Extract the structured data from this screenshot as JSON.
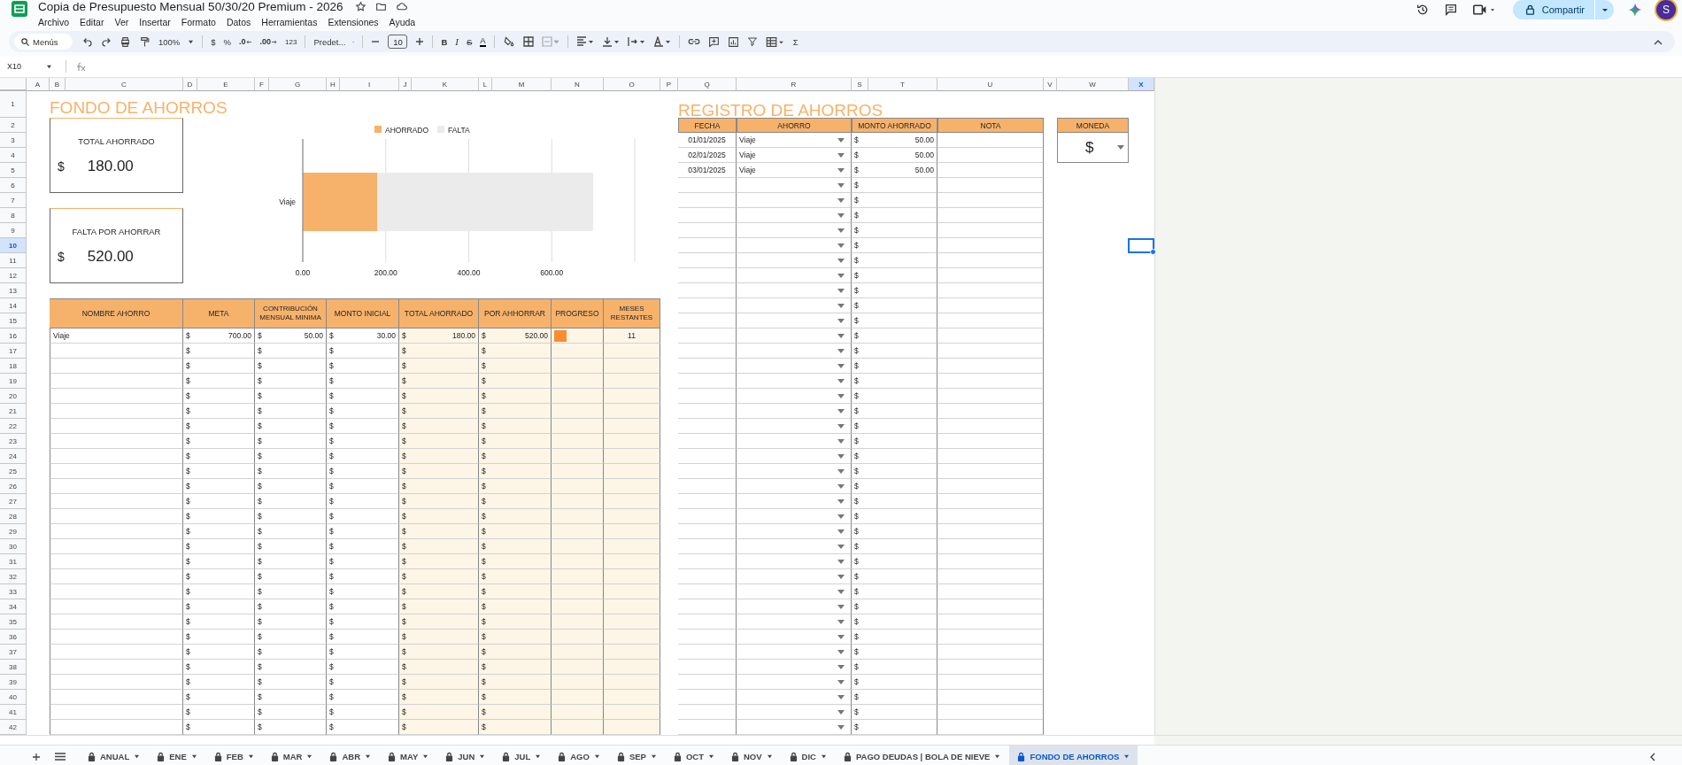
{
  "app": {
    "title": "Copia de Presupuesto Mensual 50/30/20 Premium - 2026",
    "menus": [
      "Archivo",
      "Editar",
      "Ver",
      "Insertar",
      "Formato",
      "Datos",
      "Herramientas",
      "Extensiones",
      "Ayuda"
    ],
    "share_button": "Compartir",
    "avatar": "S"
  },
  "toolbar": {
    "search_placeholder": "Menús",
    "zoom": "100%",
    "currency": "$",
    "percent": "%",
    "decrease_decimals": ".0",
    "increase_decimals": ".00",
    "number_format": "123",
    "font": "Predet...",
    "font_size": "10",
    "bold": "B",
    "italic": "I",
    "strikethrough": "S",
    "text_color": "A",
    "functions": "Σ"
  },
  "formula_bar": {
    "cell_ref": "X10"
  },
  "columns": [
    {
      "label": "A",
      "selected": false
    },
    {
      "label": "B",
      "selected": false
    },
    {
      "label": "C",
      "selected": false
    },
    {
      "label": "D",
      "selected": false
    },
    {
      "label": "E",
      "selected": false
    },
    {
      "label": "F",
      "selected": false
    },
    {
      "label": "G",
      "selected": false
    },
    {
      "label": "H",
      "selected": false
    },
    {
      "label": "I",
      "selected": false
    },
    {
      "label": "J",
      "selected": false
    },
    {
      "label": "K",
      "selected": false
    },
    {
      "label": "L",
      "selected": false
    },
    {
      "label": "M",
      "selected": false
    },
    {
      "label": "N",
      "selected": false
    },
    {
      "label": "O",
      "selected": false
    },
    {
      "label": "P",
      "selected": false
    },
    {
      "label": "Q",
      "selected": false
    },
    {
      "label": "R",
      "selected": false
    },
    {
      "label": "S",
      "selected": false
    },
    {
      "label": "T",
      "selected": false
    },
    {
      "label": "U",
      "selected": false
    },
    {
      "label": "V",
      "selected": false
    },
    {
      "label": "W",
      "selected": false
    },
    {
      "label": "X",
      "selected": true
    }
  ],
  "rows": [
    {
      "label": "1",
      "selected": false
    },
    {
      "label": "2",
      "selected": false
    },
    {
      "label": "3",
      "selected": false
    },
    {
      "label": "4",
      "selected": false
    },
    {
      "label": "5",
      "selected": false
    },
    {
      "label": "6",
      "selected": false
    },
    {
      "label": "7",
      "selected": false
    },
    {
      "label": "8",
      "selected": false
    },
    {
      "label": "9",
      "selected": false
    },
    {
      "label": "10",
      "selected": true
    },
    {
      "label": "11",
      "selected": false
    },
    {
      "label": "12",
      "selected": false
    },
    {
      "label": "13",
      "selected": false
    },
    {
      "label": "14",
      "selected": false
    },
    {
      "label": "15",
      "selected": false
    },
    {
      "label": "16",
      "selected": false
    },
    {
      "label": "17",
      "selected": false
    },
    {
      "label": "18",
      "selected": false
    },
    {
      "label": "19",
      "selected": false
    },
    {
      "label": "20",
      "selected": false
    },
    {
      "label": "21",
      "selected": false
    },
    {
      "label": "22",
      "selected": false
    },
    {
      "label": "23",
      "selected": false
    },
    {
      "label": "24",
      "selected": false
    },
    {
      "label": "25",
      "selected": false
    },
    {
      "label": "26",
      "selected": false
    },
    {
      "label": "27",
      "selected": false
    },
    {
      "label": "28",
      "selected": false
    },
    {
      "label": "29",
      "selected": false
    },
    {
      "label": "30",
      "selected": false
    },
    {
      "label": "31",
      "selected": false
    },
    {
      "label": "32",
      "selected": false
    },
    {
      "label": "33",
      "selected": false
    },
    {
      "label": "34",
      "selected": false
    },
    {
      "label": "35",
      "selected": false
    },
    {
      "label": "36",
      "selected": false
    },
    {
      "label": "37",
      "selected": false
    },
    {
      "label": "38",
      "selected": false
    },
    {
      "label": "39",
      "selected": false
    },
    {
      "label": "40",
      "selected": false
    },
    {
      "label": "41",
      "selected": false
    },
    {
      "label": "42",
      "selected": false
    }
  ],
  "savings_fund": {
    "title": "FONDO DE AHORROS",
    "cards": [
      {
        "label": "TOTAL AHORRADO",
        "currency": "$",
        "value": "180.00"
      },
      {
        "label": "FALTA POR AHORRAR",
        "currency": "$",
        "value": "520.00"
      }
    ],
    "chart_data": {
      "type": "bar",
      "orientation": "horizontal",
      "stacked": true,
      "grid": true,
      "legend": true,
      "categories": [
        "Viaje"
      ],
      "xlim": [
        0,
        800
      ],
      "xticks": [
        {
          "value": 0,
          "label": "0.00"
        },
        {
          "value": 200,
          "label": "200.00"
        },
        {
          "value": 400,
          "label": "400.00"
        },
        {
          "value": 600,
          "label": "600.00"
        }
      ],
      "series": [
        {
          "name": "AHORRADO",
          "color": "#f6b26b",
          "values": [
            180
          ]
        },
        {
          "name": "FALTA",
          "color": "#ebebeb",
          "values": [
            520
          ]
        }
      ]
    },
    "table": {
      "columns": [
        "NOMBRE AHORRO",
        "META",
        "CONTRIBUCIÓN MENSUAL MINIMA",
        "MONTO INICIAL",
        "TOTAL AHORRADO",
        "POR AHHORRAR",
        "PROGRESO",
        "MESES RESTANTES"
      ],
      "rows": [
        {
          "name": "Viaje",
          "money": [
            {
              "currency": "$",
              "amount": "700.00"
            },
            {
              "currency": "$",
              "amount": "50.00"
            },
            {
              "currency": "$",
              "amount": "30.00"
            },
            {
              "currency": "$",
              "amount": "180.00"
            },
            {
              "currency": "$",
              "amount": "520.00"
            }
          ],
          "progress": {
            "level": 0.26
          },
          "months": "11"
        },
        {
          "money": [
            {
              "currency": "$"
            },
            {
              "currency": "$"
            },
            {
              "currency": "$"
            },
            {
              "currency": "$"
            },
            {
              "currency": "$"
            }
          ]
        },
        {
          "money": [
            {
              "currency": "$"
            },
            {
              "currency": "$"
            },
            {
              "currency": "$"
            },
            {
              "currency": "$"
            },
            {
              "currency": "$"
            }
          ]
        },
        {
          "money": [
            {
              "currency": "$"
            },
            {
              "currency": "$"
            },
            {
              "currency": "$"
            },
            {
              "currency": "$"
            },
            {
              "currency": "$"
            }
          ]
        },
        {
          "money": [
            {
              "currency": "$"
            },
            {
              "currency": "$"
            },
            {
              "currency": "$"
            },
            {
              "currency": "$"
            },
            {
              "currency": "$"
            }
          ]
        },
        {
          "money": [
            {
              "currency": "$"
            },
            {
              "currency": "$"
            },
            {
              "currency": "$"
            },
            {
              "currency": "$"
            },
            {
              "currency": "$"
            }
          ]
        },
        {
          "money": [
            {
              "currency": "$"
            },
            {
              "currency": "$"
            },
            {
              "currency": "$"
            },
            {
              "currency": "$"
            },
            {
              "currency": "$"
            }
          ]
        },
        {
          "money": [
            {
              "currency": "$"
            },
            {
              "currency": "$"
            },
            {
              "currency": "$"
            },
            {
              "currency": "$"
            },
            {
              "currency": "$"
            }
          ]
        },
        {
          "money": [
            {
              "currency": "$"
            },
            {
              "currency": "$"
            },
            {
              "currency": "$"
            },
            {
              "currency": "$"
            },
            {
              "currency": "$"
            }
          ]
        },
        {
          "money": [
            {
              "currency": "$"
            },
            {
              "currency": "$"
            },
            {
              "currency": "$"
            },
            {
              "currency": "$"
            },
            {
              "currency": "$"
            }
          ]
        },
        {
          "money": [
            {
              "currency": "$"
            },
            {
              "currency": "$"
            },
            {
              "currency": "$"
            },
            {
              "currency": "$"
            },
            {
              "currency": "$"
            }
          ]
        },
        {
          "money": [
            {
              "currency": "$"
            },
            {
              "currency": "$"
            },
            {
              "currency": "$"
            },
            {
              "currency": "$"
            },
            {
              "currency": "$"
            }
          ]
        },
        {
          "money": [
            {
              "currency": "$"
            },
            {
              "currency": "$"
            },
            {
              "currency": "$"
            },
            {
              "currency": "$"
            },
            {
              "currency": "$"
            }
          ]
        },
        {
          "money": [
            {
              "currency": "$"
            },
            {
              "currency": "$"
            },
            {
              "currency": "$"
            },
            {
              "currency": "$"
            },
            {
              "currency": "$"
            }
          ]
        },
        {
          "money": [
            {
              "currency": "$"
            },
            {
              "currency": "$"
            },
            {
              "currency": "$"
            },
            {
              "currency": "$"
            },
            {
              "currency": "$"
            }
          ]
        },
        {
          "money": [
            {
              "currency": "$"
            },
            {
              "currency": "$"
            },
            {
              "currency": "$"
            },
            {
              "currency": "$"
            },
            {
              "currency": "$"
            }
          ]
        },
        {
          "money": [
            {
              "currency": "$"
            },
            {
              "currency": "$"
            },
            {
              "currency": "$"
            },
            {
              "currency": "$"
            },
            {
              "currency": "$"
            }
          ]
        },
        {
          "money": [
            {
              "currency": "$"
            },
            {
              "currency": "$"
            },
            {
              "currency": "$"
            },
            {
              "currency": "$"
            },
            {
              "currency": "$"
            }
          ]
        },
        {
          "money": [
            {
              "currency": "$"
            },
            {
              "currency": "$"
            },
            {
              "currency": "$"
            },
            {
              "currency": "$"
            },
            {
              "currency": "$"
            }
          ]
        },
        {
          "money": [
            {
              "currency": "$"
            },
            {
              "currency": "$"
            },
            {
              "currency": "$"
            },
            {
              "currency": "$"
            },
            {
              "currency": "$"
            }
          ]
        },
        {
          "money": [
            {
              "currency": "$"
            },
            {
              "currency": "$"
            },
            {
              "currency": "$"
            },
            {
              "currency": "$"
            },
            {
              "currency": "$"
            }
          ]
        },
        {
          "money": [
            {
              "currency": "$"
            },
            {
              "currency": "$"
            },
            {
              "currency": "$"
            },
            {
              "currency": "$"
            },
            {
              "currency": "$"
            }
          ]
        },
        {
          "money": [
            {
              "currency": "$"
            },
            {
              "currency": "$"
            },
            {
              "currency": "$"
            },
            {
              "currency": "$"
            },
            {
              "currency": "$"
            }
          ]
        },
        {
          "money": [
            {
              "currency": "$"
            },
            {
              "currency": "$"
            },
            {
              "currency": "$"
            },
            {
              "currency": "$"
            },
            {
              "currency": "$"
            }
          ]
        },
        {
          "money": [
            {
              "currency": "$"
            },
            {
              "currency": "$"
            },
            {
              "currency": "$"
            },
            {
              "currency": "$"
            },
            {
              "currency": "$"
            }
          ]
        },
        {
          "money": [
            {
              "currency": "$"
            },
            {
              "currency": "$"
            },
            {
              "currency": "$"
            },
            {
              "currency": "$"
            },
            {
              "currency": "$"
            }
          ]
        },
        {
          "money": [
            {
              "currency": "$"
            },
            {
              "currency": "$"
            },
            {
              "currency": "$"
            },
            {
              "currency": "$"
            },
            {
              "currency": "$"
            }
          ]
        }
      ]
    }
  },
  "savings_log": {
    "title": "REGISTRO DE AHORROS",
    "columns": [
      "FECHA",
      "AHORRO",
      "MONTO AHORRADO",
      "NOTA"
    ],
    "rows": [
      {
        "date": "01/01/2025",
        "saving": "Viaje",
        "currency": "$",
        "amount": "50.00"
      },
      {
        "date": "02/01/2025",
        "saving": "Viaje",
        "currency": "$",
        "amount": "50.00"
      },
      {
        "date": "03/01/2025",
        "saving": "Viaje",
        "currency": "$",
        "amount": "50.00"
      },
      {
        "currency": "$"
      },
      {
        "currency": "$"
      },
      {
        "currency": "$"
      },
      {
        "currency": "$"
      },
      {
        "currency": "$"
      },
      {
        "currency": "$"
      },
      {
        "currency": "$"
      },
      {
        "currency": "$"
      },
      {
        "currency": "$"
      },
      {
        "currency": "$"
      },
      {
        "currency": "$"
      },
      {
        "currency": "$"
      },
      {
        "currency": "$"
      },
      {
        "currency": "$"
      },
      {
        "currency": "$"
      },
      {
        "currency": "$"
      },
      {
        "currency": "$"
      },
      {
        "currency": "$"
      },
      {
        "currency": "$"
      },
      {
        "currency": "$"
      },
      {
        "currency": "$"
      },
      {
        "currency": "$"
      },
      {
        "currency": "$"
      },
      {
        "currency": "$"
      },
      {
        "currency": "$"
      },
      {
        "currency": "$"
      },
      {
        "currency": "$"
      },
      {
        "currency": "$"
      },
      {
        "currency": "$"
      },
      {
        "currency": "$"
      },
      {
        "currency": "$"
      },
      {
        "currency": "$"
      },
      {
        "currency": "$"
      },
      {
        "currency": "$"
      },
      {
        "currency": "$"
      },
      {
        "currency": "$"
      },
      {
        "currency": "$"
      }
    ]
  },
  "currency_box": {
    "header": "MONEDA",
    "value": "$"
  },
  "sheet_tabs": [
    {
      "label": "ANUAL",
      "locked": true,
      "selected": false
    },
    {
      "label": "ENE",
      "locked": true,
      "selected": false
    },
    {
      "label": "FEB",
      "locked": true,
      "selected": false
    },
    {
      "label": "MAR",
      "locked": true,
      "selected": false
    },
    {
      "label": "ABR",
      "locked": true,
      "selected": false
    },
    {
      "label": "MAY",
      "locked": true,
      "selected": false
    },
    {
      "label": "JUN",
      "locked": true,
      "selected": false
    },
    {
      "label": "JUL",
      "locked": true,
      "selected": false
    },
    {
      "label": "AGO",
      "locked": true,
      "selected": false
    },
    {
      "label": "SEP",
      "locked": true,
      "selected": false
    },
    {
      "label": "OCT",
      "locked": true,
      "selected": false
    },
    {
      "label": "NOV",
      "locked": true,
      "selected": false
    },
    {
      "label": "DIC",
      "locked": true,
      "selected": false
    },
    {
      "label": "PAGO DEUDAS | BOLA DE NIEVE",
      "locked": true,
      "selected": false
    },
    {
      "label": "FONDO DE AHORROS",
      "locked": true,
      "selected": true
    }
  ]
}
